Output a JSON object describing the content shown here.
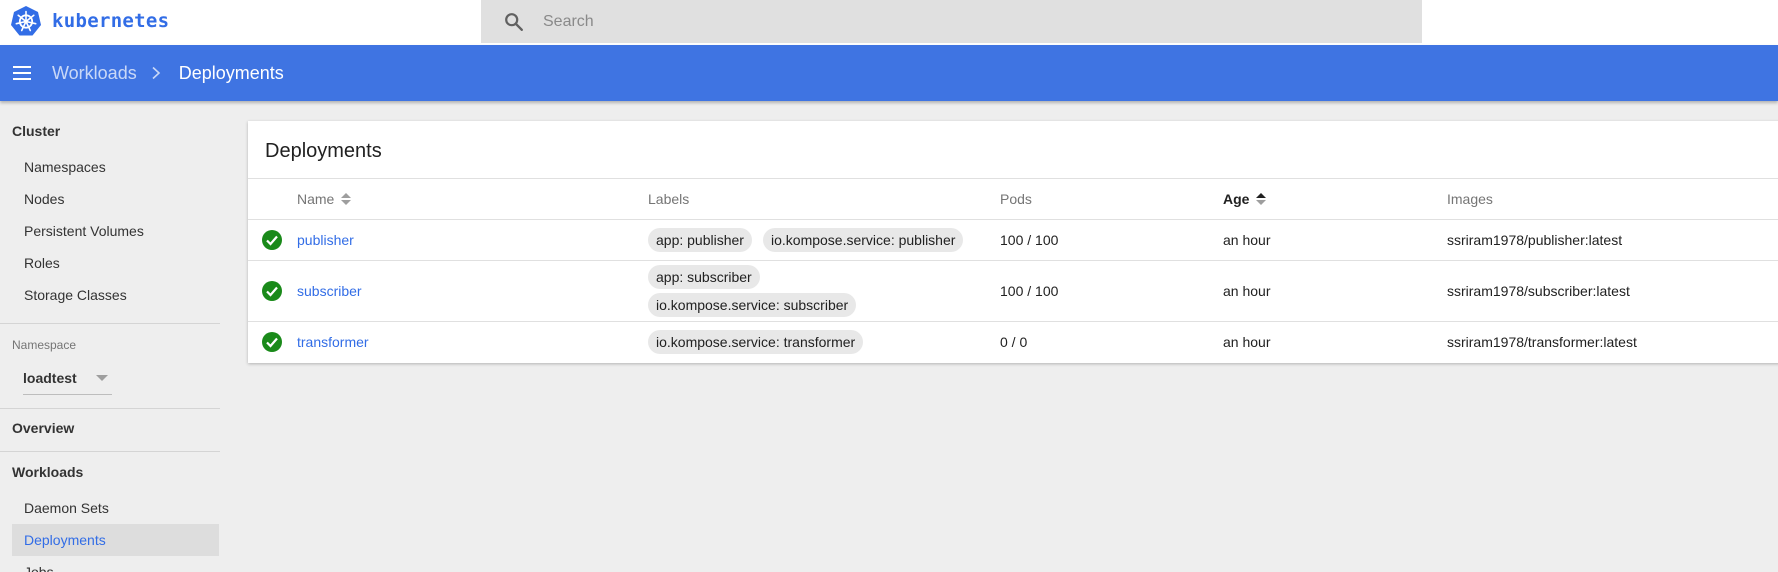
{
  "app": {
    "name": "kubernetes"
  },
  "search": {
    "placeholder": "Search"
  },
  "breadcrumb": {
    "parent": "Workloads",
    "current": "Deployments"
  },
  "sidebar": {
    "cluster_title": "Cluster",
    "cluster_items": [
      "Namespaces",
      "Nodes",
      "Persistent Volumes",
      "Roles",
      "Storage Classes"
    ],
    "namespace_label": "Namespace",
    "namespace_value": "loadtest",
    "overview": "Overview",
    "workloads_title": "Workloads",
    "workload_items": [
      "Daemon Sets",
      "Deployments",
      "Jobs"
    ],
    "active_item": "Deployments"
  },
  "card": {
    "title": "Deployments",
    "columns": {
      "name": "Name",
      "labels": "Labels",
      "pods": "Pods",
      "age": "Age",
      "images": "Images"
    },
    "rows": [
      {
        "status": "ok",
        "name": "publisher",
        "labels": [
          "app: publisher",
          "io.kompose.service: publisher"
        ],
        "pods": "100 / 100",
        "age": "an hour",
        "image": "ssriram1978/publisher:latest"
      },
      {
        "status": "ok",
        "name": "subscriber",
        "labels": [
          "app: subscriber",
          "io.kompose.service: subscriber"
        ],
        "pods": "100 / 100",
        "age": "an hour",
        "image": "ssriram1978/subscriber:latest"
      },
      {
        "status": "ok",
        "name": "transformer",
        "labels": [
          "io.kompose.service: transformer"
        ],
        "pods": "0 / 0",
        "age": "an hour",
        "image": "ssriram1978/transformer:latest"
      }
    ]
  },
  "colors": {
    "brand": "#326de6",
    "toolbar": "#3f74e2",
    "ok": "#1a8a1a"
  }
}
